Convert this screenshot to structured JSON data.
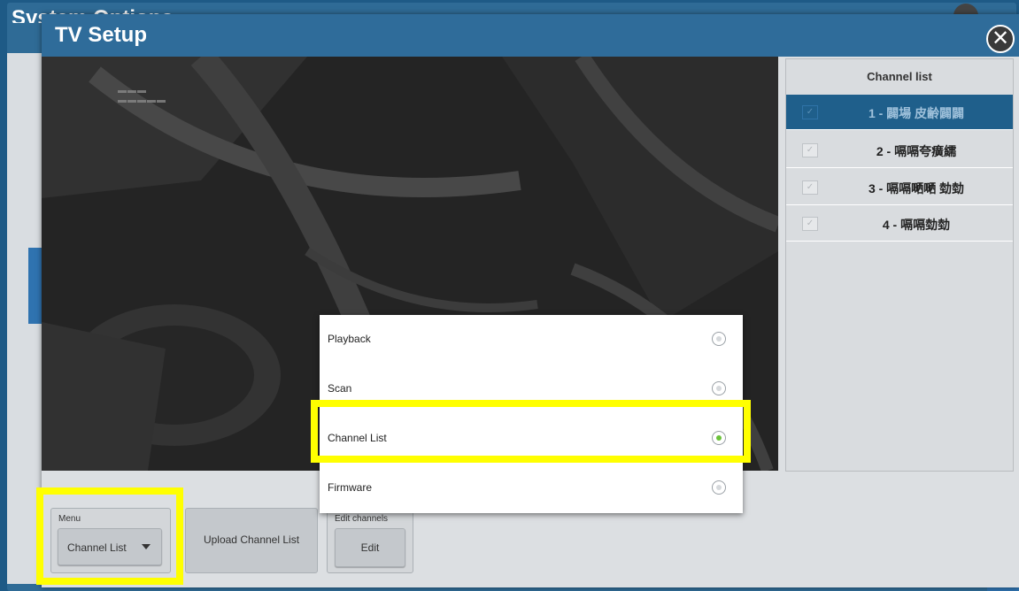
{
  "background_window": {
    "title": "System Options"
  },
  "dialog": {
    "title": "TV Setup",
    "close_icon": "close-icon"
  },
  "channel_list": {
    "title": "Channel list",
    "items": [
      {
        "label": "1 - 闢場 皮齢闢闢",
        "active": true
      },
      {
        "label": "2 - 嗝嗝夸癀繻",
        "active": false
      },
      {
        "label": "3 - 嗝嗝嗮嗮 勎勎",
        "active": false
      },
      {
        "label": "4 - 嗝嗝勎勎",
        "active": false
      }
    ]
  },
  "controls": {
    "menu_caption": "Menu",
    "menu_value": "Channel List",
    "upload_label": "Upload Channel List",
    "edit_caption": "Edit channels",
    "edit_label": "Edit"
  },
  "popup": {
    "options": [
      {
        "label": "Playback",
        "selected": false
      },
      {
        "label": "Scan",
        "selected": false
      },
      {
        "label": "Channel List",
        "selected": true
      },
      {
        "label": "Firmware",
        "selected": false
      }
    ]
  },
  "colors": {
    "header": "#2f6c9a",
    "active_channel": "#1f5f8b",
    "highlight": "#ffff00",
    "radio_selected": "#6bc23a"
  }
}
